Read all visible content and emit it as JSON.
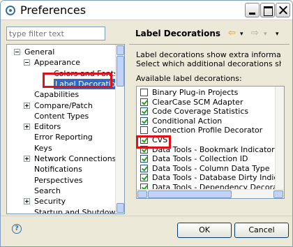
{
  "window": {
    "title": "Preferences"
  },
  "filter": {
    "placeholder": "type filter text"
  },
  "tree": [
    {
      "label": "General",
      "expander": "minus",
      "level": 0
    },
    {
      "label": "Appearance",
      "expander": "minus",
      "level": 1
    },
    {
      "label": "Colors and Fonts",
      "expander": "none",
      "level": 2
    },
    {
      "label": "Label Decorations",
      "expander": "none",
      "level": 2,
      "selected": true
    },
    {
      "label": "Capabilities",
      "expander": "none",
      "level": 1
    },
    {
      "label": "Compare/Patch",
      "expander": "plus",
      "level": 1
    },
    {
      "label": "Content Types",
      "expander": "none",
      "level": 1
    },
    {
      "label": "Editors",
      "expander": "plus",
      "level": 1
    },
    {
      "label": "Error Reporting",
      "expander": "none",
      "level": 1
    },
    {
      "label": "Keys",
      "expander": "none",
      "level": 1
    },
    {
      "label": "Network Connections",
      "expander": "plus",
      "level": 1
    },
    {
      "label": "Notifications",
      "expander": "none",
      "level": 1
    },
    {
      "label": "Perspectives",
      "expander": "none",
      "level": 1
    },
    {
      "label": "Search",
      "expander": "none",
      "level": 1
    },
    {
      "label": "Security",
      "expander": "plus",
      "level": 1
    },
    {
      "label": "Startup and Shutdown",
      "expander": "none",
      "level": 1
    }
  ],
  "right": {
    "title": "Label Decorations",
    "back_icon": "⇦",
    "forward_icon": "⇨",
    "menu_icon": "▾",
    "desc1": "Label decorations show extra information a",
    "desc2": "Select which additional decorations should b",
    "list_header": "Available label decorations:",
    "items": [
      {
        "label": "Binary Plug-in Projects",
        "checked": false
      },
      {
        "label": "ClearCase SCM Adapter",
        "checked": true
      },
      {
        "label": "Code Coverage Statistics",
        "checked": true
      },
      {
        "label": "Conditional Action",
        "checked": true
      },
      {
        "label": "Connection Profile Decorator",
        "checked": false
      },
      {
        "label": "CVS",
        "checked": true
      },
      {
        "label": "Data Tools - Bookmark Indicator",
        "checked": true
      },
      {
        "label": "Data Tools - Collection ID",
        "checked": true
      },
      {
        "label": "Data Tools - Column Data Type",
        "checked": true
      },
      {
        "label": "Data Tools - Database Dirty Indicator",
        "checked": true
      },
      {
        "label": "Data Tools - Dependency Decoration",
        "checked": true
      }
    ]
  },
  "buttons": {
    "ok": "OK",
    "cancel": "Cancel",
    "help": "?"
  },
  "colors": {
    "highlight": "#e0101a",
    "selection": "#316ac5",
    "border": "#7f9db9"
  }
}
